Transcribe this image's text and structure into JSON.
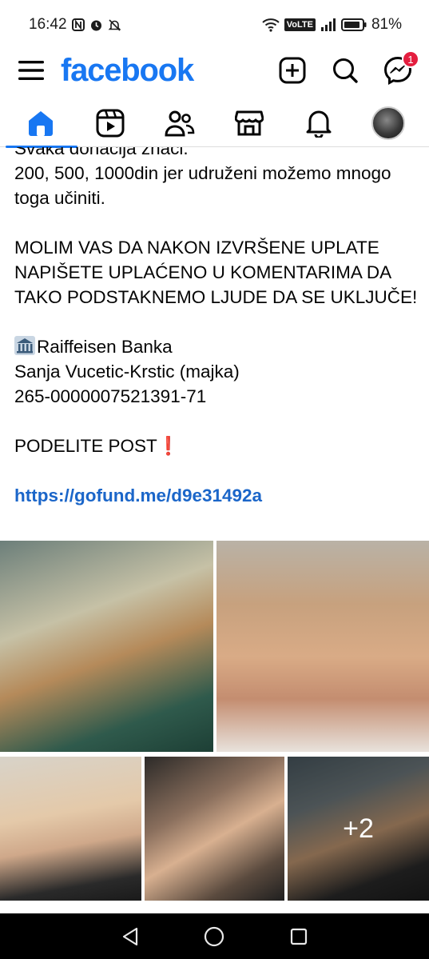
{
  "status_bar": {
    "time": "16:42",
    "network": "VoLTE",
    "battery": "81%"
  },
  "header": {
    "logo": "facebook",
    "messenger_badge": "1"
  },
  "tabs": [
    {
      "name": "home",
      "icon": "home-icon",
      "active": true
    },
    {
      "name": "video",
      "icon": "video-icon",
      "active": false
    },
    {
      "name": "friends",
      "icon": "friends-icon",
      "active": false
    },
    {
      "name": "marketplace",
      "icon": "marketplace-icon",
      "active": false
    },
    {
      "name": "notifications",
      "icon": "bell-icon",
      "active": false
    },
    {
      "name": "profile",
      "icon": "avatar",
      "active": false
    }
  ],
  "post": {
    "line1": "Svaka donacija znači.",
    "line2": "200, 500, 1000din jer udruženi možemo mnogo toga učiniti.",
    "appeal": "MOLIM VAS DA NAKON IZVRŠENE UPLATE NAPIŠETE UPLAĆENO U KOMENTARIMA DA TAKO PODSTAKNEMO LJUDE DA SE UKLJUČE!",
    "bank": "Raiffeisen Banka",
    "account_holder": "Sanja Vucetic-Krstic (majka)",
    "account_number": "265-0000007521391-71",
    "share": "PODELITE POST",
    "share_mark": "❗",
    "link": "https://gofund.me/d9e31492a"
  },
  "photos": {
    "more_count": "+2"
  },
  "colors": {
    "brand": "#1877f2",
    "link": "#1b66c9",
    "badge": "#e41e3f"
  }
}
